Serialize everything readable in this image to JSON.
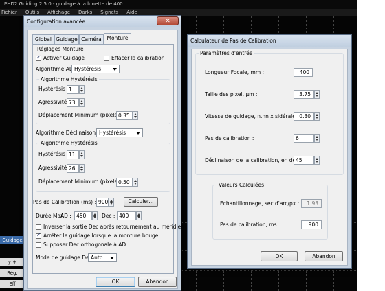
{
  "app": {
    "title": "PHD2 Guiding 2.5.0 - guidage à la lunette de 400",
    "menu": [
      "Fichier",
      "Outils",
      "Affichage",
      "Darks",
      "Signets",
      "Aide"
    ],
    "left_panel": [
      "Guidage",
      "y +",
      "Rég.",
      "Eff"
    ]
  },
  "config": {
    "title": "Configuration avancée",
    "close": "✕",
    "tabs": [
      "Global",
      "Guidage",
      "Caméra",
      "Monture"
    ],
    "section": "Réglages Monture",
    "enable_guiding": {
      "label": "Activer Guidage",
      "checked": true
    },
    "clear_calib": {
      "label": "Effacer la calibration",
      "checked": false
    },
    "ra_algo": {
      "label": "Algorithme AD :",
      "value": "Hystérésis"
    },
    "ra_group": "Algorithme Hystérésis",
    "ra_hysteresis": {
      "label": "Hystérésis :",
      "value": "1"
    },
    "ra_aggr": {
      "label": "Agressivité :",
      "value": "73"
    },
    "ra_min": {
      "label": "Déplacement Minimum (pixels) :",
      "value": "0.35"
    },
    "dec_algo": {
      "label": "Algorithme Déclinaison :",
      "value": "Hystérésis"
    },
    "dec_group": "Algorithme Hystérésis",
    "dec_hysteresis": {
      "label": "Hystérésis :",
      "value": "11"
    },
    "dec_aggr": {
      "label": "Agressivité :",
      "value": "26"
    },
    "dec_min": {
      "label": "Déplacement Minimum (pixels) :",
      "value": "0.50"
    },
    "calib_step": {
      "label": "Pas de Calibration (ms) :",
      "value": "900",
      "button": "Calculer..."
    },
    "max_dur": {
      "label": "Durée Max",
      "ra_label": "AD :",
      "ra_value": "450",
      "dec_label": "Dec :",
      "dec_value": "400"
    },
    "invert": {
      "label": "Inverser la sortie Dec après retournement au méridien",
      "checked": false
    },
    "stop_guide": {
      "label": "Arrêter le guidage lorsque la monture bouge",
      "checked": true
    },
    "assume_ortho": {
      "label": "Supposer Dec orthogonale à AD",
      "checked": false
    },
    "dec_mode": {
      "label": "Mode de guidage Dec :",
      "value": "Auto"
    },
    "ok": "OK",
    "cancel": "Abandon"
  },
  "calc": {
    "title": "Calculateur de Pas de Calibration",
    "inputs_group": "Paramètres d'entrée",
    "focal": {
      "label": "Longueur Focale, mm :",
      "value": "400"
    },
    "pixel": {
      "label": "Taille des pixel, µm :",
      "value": "3.75"
    },
    "speed": {
      "label": "Vitesse de guidage, n.nn x sidérale :",
      "value": "0.30"
    },
    "steps": {
      "label": "Pas de calibration :",
      "value": "6"
    },
    "decl": {
      "label": "Déclinaison de la calibration, en degrés :",
      "value": "45"
    },
    "computed_group": "Valeurs Calculées",
    "sampling": {
      "label": "Echantillonnage, sec d'arc/px :",
      "value": "1.93"
    },
    "step_ms": {
      "label": "Pas de calibration, ms :",
      "value": "900"
    },
    "ok": "OK",
    "cancel": "Abandon"
  }
}
